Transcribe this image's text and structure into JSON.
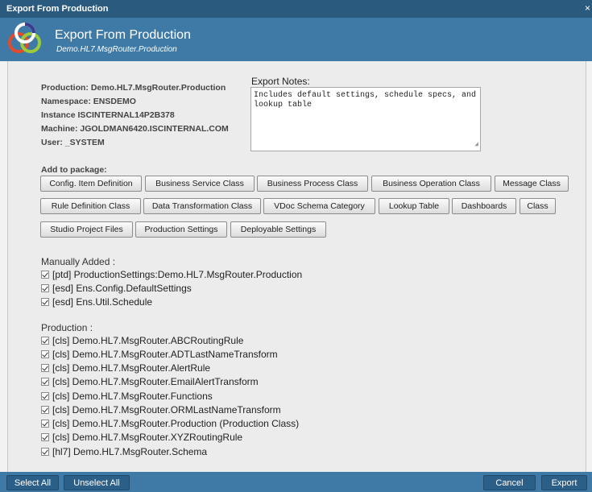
{
  "window": {
    "title": "Export From Production",
    "close_glyph": "×"
  },
  "header": {
    "title": "Export From Production",
    "subtitle": "Demo.HL7.MsgRouter.Production",
    "logo_icon": "interlinked-rings-logo"
  },
  "info": {
    "production": "Production: Demo.HL7.MsgRouter.Production",
    "namespace": "Namespace: ENSDEMO",
    "instance": "Instance ISCINTERNAL14P2B378",
    "machine": "Machine: JGOLDMAN6420.ISCINTERNAL.COM",
    "user": "User: _SYSTEM"
  },
  "notes": {
    "label": "Export Notes:",
    "value": "Includes default settings, schedule specs, and lookup table"
  },
  "add_package": {
    "label": "Add to package:",
    "buttons": [
      "Config. Item Definition",
      "Business Service Class",
      "Business Process Class",
      "Business Operation Class",
      "Message Class",
      "Rule Definition Class",
      "Data Transformation Class",
      "VDoc Schema Category",
      "Lookup Table",
      "Dashboards",
      "Class",
      "Studio Project Files",
      "Production Settings",
      "Deployable Settings"
    ]
  },
  "manual": {
    "label": "Manually Added :",
    "items": [
      "[ptd] ProductionSettings:Demo.HL7.MsgRouter.Production",
      "[esd] Ens.Config.DefaultSettings",
      "[esd] Ens.Util.Schedule"
    ]
  },
  "production": {
    "label": "Production :",
    "items": [
      "[cls] Demo.HL7.MsgRouter.ABCRoutingRule",
      "[cls] Demo.HL7.MsgRouter.ADTLastNameTransform",
      "[cls] Demo.HL7.MsgRouter.AlertRule",
      "[cls] Demo.HL7.MsgRouter.EmailAlertTransform",
      "[cls] Demo.HL7.MsgRouter.Functions",
      "[cls] Demo.HL7.MsgRouter.ORMLastNameTransform",
      "[cls] Demo.HL7.MsgRouter.Production (Production Class)",
      "[cls] Demo.HL7.MsgRouter.XYZRoutingRule",
      "[hl7] Demo.HL7.MsgRouter.Schema"
    ]
  },
  "footer": {
    "select_all": "Select All",
    "unselect_all": "Unselect All",
    "cancel": "Cancel",
    "export": "Export"
  }
}
